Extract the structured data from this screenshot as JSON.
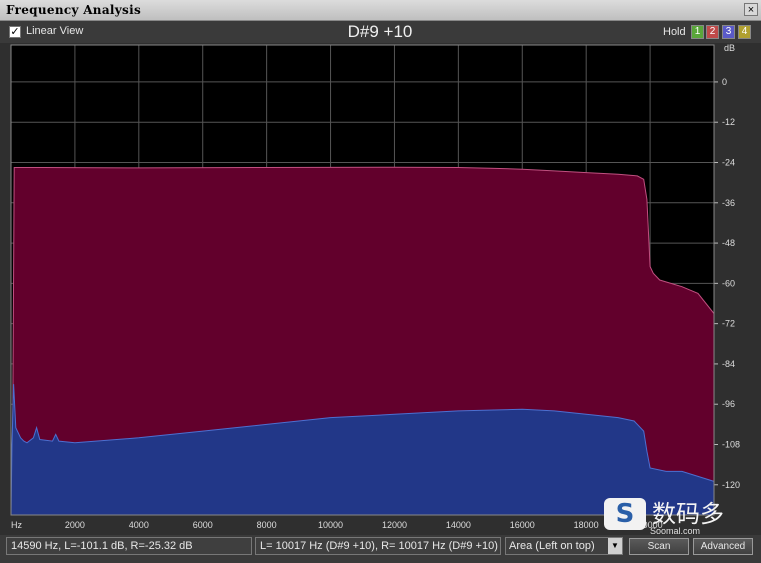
{
  "window": {
    "title": "Frequency Analysis",
    "close_glyph": "×"
  },
  "toolbar": {
    "linear_view_checked": true,
    "linear_view_label": "Linear View",
    "note_label": "D#9 +10",
    "hold_label": "Hold",
    "hold_buttons": [
      {
        "label": "1",
        "color": "#5aa63a"
      },
      {
        "label": "2",
        "color": "#c04a4a"
      },
      {
        "label": "3",
        "color": "#5a5ac8"
      },
      {
        "label": "4",
        "color": "#b0a030"
      }
    ]
  },
  "chart_data": {
    "type": "area",
    "x_unit_label": "Hz",
    "x_ticks": [
      2000,
      4000,
      6000,
      8000,
      10000,
      12000,
      14000,
      16000,
      18000,
      20000
    ],
    "xlim": [
      0,
      22000
    ],
    "y_unit_label": "dB",
    "y_ticks": [
      0,
      -12,
      -24,
      -36,
      -48,
      -60,
      -72,
      -84,
      -96,
      -108,
      -120
    ],
    "ylim": [
      -129,
      11
    ],
    "grid": true,
    "series": [
      {
        "color": "#62002c",
        "x": [
          0,
          50,
          100,
          1000,
          4000,
          8000,
          12000,
          14000,
          15000,
          16000,
          17000,
          18000,
          19000,
          19600,
          19800,
          19900,
          20000,
          20100,
          20300,
          21000,
          21500,
          22000
        ],
        "y": [
          -129,
          -109,
          -25.5,
          -25.5,
          -25.6,
          -25.5,
          -25.4,
          -25.5,
          -25.7,
          -26,
          -26.5,
          -27,
          -27.5,
          -28,
          -29,
          -35,
          -55,
          -57,
          -59,
          -61,
          -63,
          -69
        ]
      },
      {
        "color": "#223788",
        "x": [
          0,
          30,
          80,
          150,
          300,
          400,
          500,
          700,
          800,
          900,
          1300,
          1400,
          1500,
          2000,
          4000,
          6000,
          8000,
          10000,
          12000,
          14000,
          16000,
          17000,
          18000,
          19000,
          19500,
          19800,
          19900,
          20000,
          20500,
          21000,
          21500,
          22000
        ],
        "y": [
          -129,
          -108,
          -90,
          -103,
          -106,
          -107,
          -107.5,
          -106,
          -103,
          -106.5,
          -107,
          -105,
          -107,
          -107.5,
          -106,
          -104,
          -102,
          -100,
          -99,
          -98,
          -97.5,
          -98,
          -99,
          -100,
          -101,
          -104,
          -110,
          -115,
          -116,
          -116,
          -117.5,
          -119
        ]
      }
    ]
  },
  "status": {
    "cursor_readout": "14590 Hz, L=-101.1 dB, R=-25.32 dB",
    "peak_readout": "L=  10017 Hz (D#9 +10), R=  10017 Hz (D#9 +10)",
    "display_mode": "Area (Left on top)",
    "scan_label": "Scan",
    "advanced_label": "Advanced"
  },
  "watermark": {
    "logo_letter": "S",
    "text": "数码多",
    "domain": "Soomal.com"
  }
}
